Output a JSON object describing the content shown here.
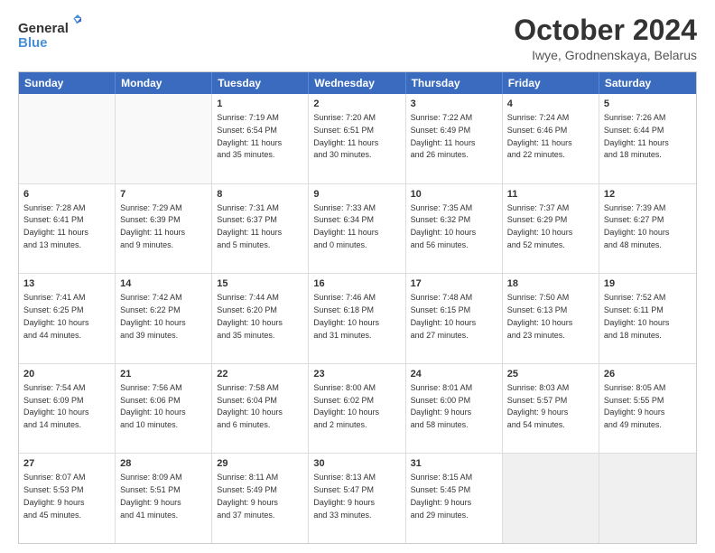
{
  "logo": {
    "line1": "General",
    "line2": "Blue"
  },
  "title": "October 2024",
  "location": "Iwye, Grodnenskaya, Belarus",
  "header_days": [
    "Sunday",
    "Monday",
    "Tuesday",
    "Wednesday",
    "Thursday",
    "Friday",
    "Saturday"
  ],
  "weeks": [
    [
      {
        "day": "",
        "info": ""
      },
      {
        "day": "",
        "info": ""
      },
      {
        "day": "1",
        "info": "Sunrise: 7:19 AM\nSunset: 6:54 PM\nDaylight: 11 hours\nand 35 minutes."
      },
      {
        "day": "2",
        "info": "Sunrise: 7:20 AM\nSunset: 6:51 PM\nDaylight: 11 hours\nand 30 minutes."
      },
      {
        "day": "3",
        "info": "Sunrise: 7:22 AM\nSunset: 6:49 PM\nDaylight: 11 hours\nand 26 minutes."
      },
      {
        "day": "4",
        "info": "Sunrise: 7:24 AM\nSunset: 6:46 PM\nDaylight: 11 hours\nand 22 minutes."
      },
      {
        "day": "5",
        "info": "Sunrise: 7:26 AM\nSunset: 6:44 PM\nDaylight: 11 hours\nand 18 minutes."
      }
    ],
    [
      {
        "day": "6",
        "info": "Sunrise: 7:28 AM\nSunset: 6:41 PM\nDaylight: 11 hours\nand 13 minutes."
      },
      {
        "day": "7",
        "info": "Sunrise: 7:29 AM\nSunset: 6:39 PM\nDaylight: 11 hours\nand 9 minutes."
      },
      {
        "day": "8",
        "info": "Sunrise: 7:31 AM\nSunset: 6:37 PM\nDaylight: 11 hours\nand 5 minutes."
      },
      {
        "day": "9",
        "info": "Sunrise: 7:33 AM\nSunset: 6:34 PM\nDaylight: 11 hours\nand 0 minutes."
      },
      {
        "day": "10",
        "info": "Sunrise: 7:35 AM\nSunset: 6:32 PM\nDaylight: 10 hours\nand 56 minutes."
      },
      {
        "day": "11",
        "info": "Sunrise: 7:37 AM\nSunset: 6:29 PM\nDaylight: 10 hours\nand 52 minutes."
      },
      {
        "day": "12",
        "info": "Sunrise: 7:39 AM\nSunset: 6:27 PM\nDaylight: 10 hours\nand 48 minutes."
      }
    ],
    [
      {
        "day": "13",
        "info": "Sunrise: 7:41 AM\nSunset: 6:25 PM\nDaylight: 10 hours\nand 44 minutes."
      },
      {
        "day": "14",
        "info": "Sunrise: 7:42 AM\nSunset: 6:22 PM\nDaylight: 10 hours\nand 39 minutes."
      },
      {
        "day": "15",
        "info": "Sunrise: 7:44 AM\nSunset: 6:20 PM\nDaylight: 10 hours\nand 35 minutes."
      },
      {
        "day": "16",
        "info": "Sunrise: 7:46 AM\nSunset: 6:18 PM\nDaylight: 10 hours\nand 31 minutes."
      },
      {
        "day": "17",
        "info": "Sunrise: 7:48 AM\nSunset: 6:15 PM\nDaylight: 10 hours\nand 27 minutes."
      },
      {
        "day": "18",
        "info": "Sunrise: 7:50 AM\nSunset: 6:13 PM\nDaylight: 10 hours\nand 23 minutes."
      },
      {
        "day": "19",
        "info": "Sunrise: 7:52 AM\nSunset: 6:11 PM\nDaylight: 10 hours\nand 18 minutes."
      }
    ],
    [
      {
        "day": "20",
        "info": "Sunrise: 7:54 AM\nSunset: 6:09 PM\nDaylight: 10 hours\nand 14 minutes."
      },
      {
        "day": "21",
        "info": "Sunrise: 7:56 AM\nSunset: 6:06 PM\nDaylight: 10 hours\nand 10 minutes."
      },
      {
        "day": "22",
        "info": "Sunrise: 7:58 AM\nSunset: 6:04 PM\nDaylight: 10 hours\nand 6 minutes."
      },
      {
        "day": "23",
        "info": "Sunrise: 8:00 AM\nSunset: 6:02 PM\nDaylight: 10 hours\nand 2 minutes."
      },
      {
        "day": "24",
        "info": "Sunrise: 8:01 AM\nSunset: 6:00 PM\nDaylight: 9 hours\nand 58 minutes."
      },
      {
        "day": "25",
        "info": "Sunrise: 8:03 AM\nSunset: 5:57 PM\nDaylight: 9 hours\nand 54 minutes."
      },
      {
        "day": "26",
        "info": "Sunrise: 8:05 AM\nSunset: 5:55 PM\nDaylight: 9 hours\nand 49 minutes."
      }
    ],
    [
      {
        "day": "27",
        "info": "Sunrise: 8:07 AM\nSunset: 5:53 PM\nDaylight: 9 hours\nand 45 minutes."
      },
      {
        "day": "28",
        "info": "Sunrise: 8:09 AM\nSunset: 5:51 PM\nDaylight: 9 hours\nand 41 minutes."
      },
      {
        "day": "29",
        "info": "Sunrise: 8:11 AM\nSunset: 5:49 PM\nDaylight: 9 hours\nand 37 minutes."
      },
      {
        "day": "30",
        "info": "Sunrise: 8:13 AM\nSunset: 5:47 PM\nDaylight: 9 hours\nand 33 minutes."
      },
      {
        "day": "31",
        "info": "Sunrise: 8:15 AM\nSunset: 5:45 PM\nDaylight: 9 hours\nand 29 minutes."
      },
      {
        "day": "",
        "info": ""
      },
      {
        "day": "",
        "info": ""
      }
    ]
  ]
}
